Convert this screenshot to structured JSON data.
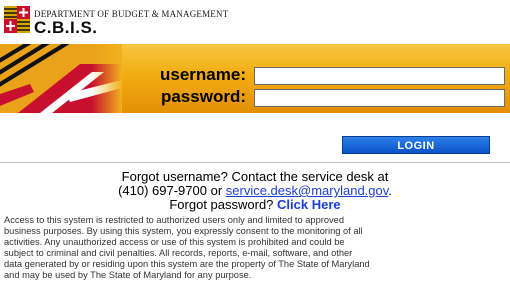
{
  "header": {
    "department": "DEPARTMENT OF BUDGET & MANAGEMENT",
    "system_name": "C.B.I.S."
  },
  "login_form": {
    "username_label": "username:",
    "password_label": "password:",
    "username_value": "",
    "password_value": "",
    "login_label": "LOGIN"
  },
  "help": {
    "forgot_username": "Forgot username? Contact the service desk at",
    "phone_prefix": "(410) 697-9700 or ",
    "email": "service.desk@maryland.gov",
    "email_suffix": ".",
    "forgot_password": "Forgot password? ",
    "click_here": "Click Here"
  },
  "legal": [
    "Access to this system is restricted to authorized users only and limited to approved",
    "business purposes. By using this system, you expressly consent to the monitoring of all",
    "activities. Any unauthorized access or use of this system is prohibited and could be",
    "subject to criminal and civil penalties. All records, reports, e-mail, software, and other",
    "data generated by or residing upon this system are the property of The State of Maryland",
    "and may be used by The State of Maryland for any purpose."
  ],
  "colors": {
    "banner": "#f1ad12",
    "button": "#0a54c9",
    "link": "#1f3fd8"
  }
}
